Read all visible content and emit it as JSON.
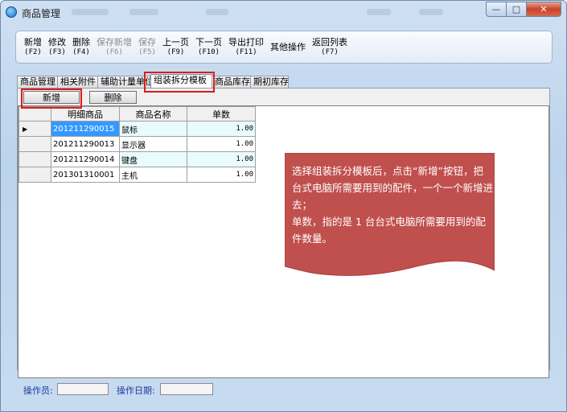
{
  "window": {
    "title": "商品管理"
  },
  "toolbar": {
    "buttons": [
      {
        "label": "新增",
        "key": "(F2)",
        "enabled": true
      },
      {
        "label": "修改",
        "key": "(F3)",
        "enabled": true
      },
      {
        "label": "删除",
        "key": "(F4)",
        "enabled": true
      },
      {
        "label": "保存新增",
        "key": "(F6)",
        "enabled": false
      },
      {
        "label": "保存",
        "key": "(F5)",
        "enabled": false
      },
      {
        "label": "上一页",
        "key": "(F9)",
        "enabled": true
      },
      {
        "label": "下一页",
        "key": "(F10)",
        "enabled": true
      },
      {
        "label": "导出打印",
        "key": "(F11)",
        "enabled": true
      },
      {
        "label": "其他操作",
        "key": "",
        "enabled": true
      },
      {
        "label": "返回列表",
        "key": "(F7)",
        "enabled": true
      }
    ]
  },
  "tabs": [
    "商品管理",
    "相关附件",
    "辅助计量单位",
    "组装拆分模板",
    "商品库存",
    "期初库存"
  ],
  "active_tab_index": 3,
  "actions": {
    "add_label": "新增",
    "delete_label": "删除"
  },
  "table": {
    "columns": [
      "明细商品",
      "商品名称",
      "单数"
    ],
    "rows": [
      {
        "code": "201211290015",
        "name": "鼠标",
        "qty": "1.00"
      },
      {
        "code": "201211290013",
        "name": "显示器",
        "qty": "1.00"
      },
      {
        "code": "201211290014",
        "name": "键盘",
        "qty": "1.00"
      },
      {
        "code": "201301310001",
        "name": "主机",
        "qty": "1.00"
      }
    ]
  },
  "callout": {
    "line1": "选择组装拆分模板后，点击“新增”按钮，把台式电脑所需要用到的配件，一个一个新增进去；",
    "line2": "单数，指的是 1 台台式电脑所需要用到的配件数量。",
    "color": "#c0504d"
  },
  "footer": {
    "operator_label": "操作员:",
    "operator_value": "",
    "date_label": "操作日期:",
    "date_value": ""
  },
  "colors": {
    "highlight": "#e01a1a",
    "selection": "#3399ff",
    "footer_label": "#1a3aa0"
  }
}
